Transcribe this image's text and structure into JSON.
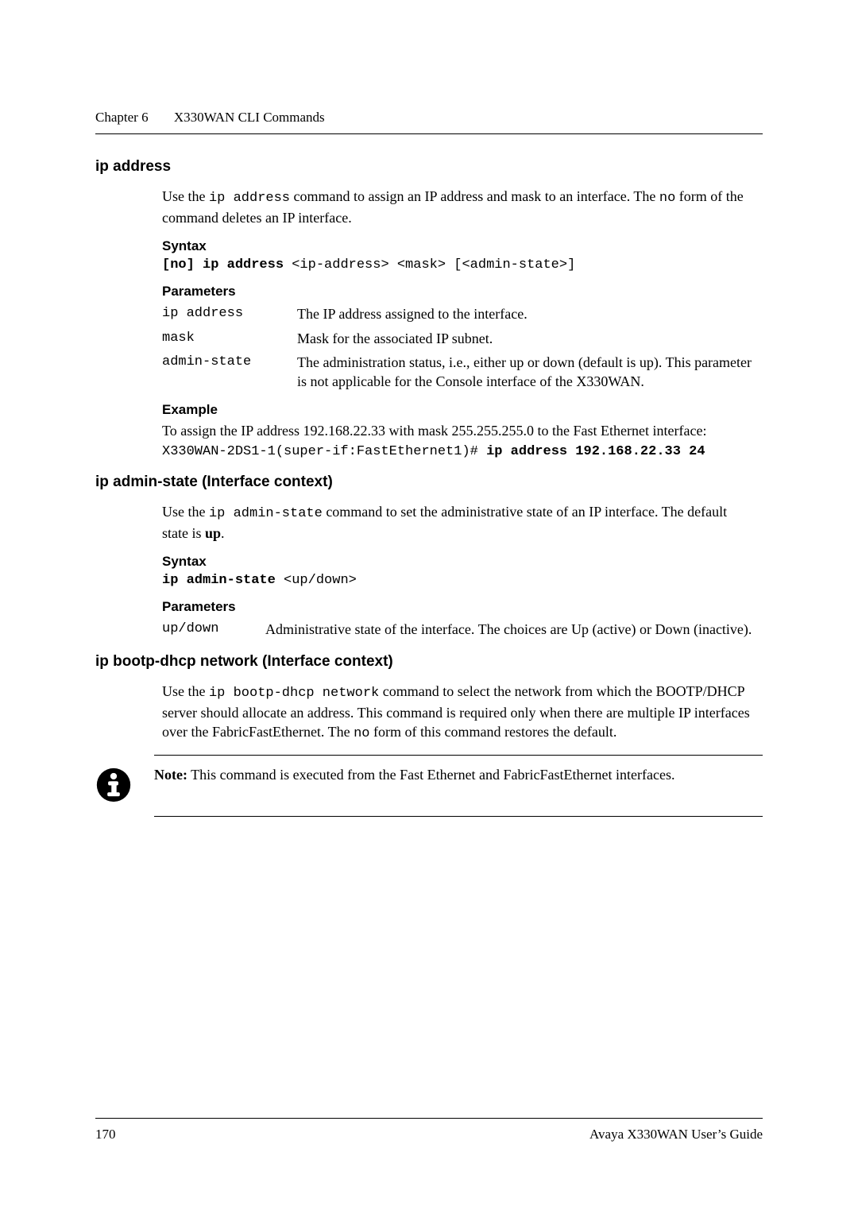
{
  "runhead": {
    "chapter": "Chapter 6",
    "title": "X330WAN CLI Commands"
  },
  "sec1": {
    "title": "ip address",
    "intro_pre": "Use the  ",
    "intro_code": "ip address",
    "intro_mid": "  command to assign an IP address and mask to an interface. The ",
    "intro_code2": "no",
    "intro_post": " form of the command deletes an IP interface.",
    "syntax_head": "Syntax",
    "syntax_bold": "[no] ip address",
    "syntax_rest": " <ip-address> <mask> [<admin-state>]",
    "params_head": "Parameters",
    "params": [
      {
        "key": "ip address",
        "desc": "The IP address assigned to the interface."
      },
      {
        "key": "mask",
        "desc": "Mask for the associated IP subnet."
      },
      {
        "key": "admin-state",
        "desc": "The administration status, i.e., either up or down (default is up). This parameter is not applicable for the Console interface of the X330WAN."
      }
    ],
    "example_head": "Example",
    "example_intro": "To assign the IP address 192.168.22.33 with mask 255.255.255.0 to the Fast Ethernet interface:",
    "example_prompt": "X330WAN-2DS1-1(super-if:FastEthernet1)# ",
    "example_bold": "ip address 192.168.22.33 24"
  },
  "sec2": {
    "title": "ip admin-state (Interface context)",
    "intro_pre": "Use the  ",
    "intro_code": "ip admin-state",
    "intro_mid": " command to set the administrative state of an IP interface. The default state is ",
    "intro_bold": "up",
    "intro_post": ".",
    "syntax_head": "Syntax",
    "syntax_bold": "ip admin-state",
    "syntax_rest": " <up/down>",
    "params_head": "Parameters",
    "params": [
      {
        "key": "up/down",
        "desc": "Administrative state of the interface. The choices are Up (active) or Down (inactive)."
      }
    ]
  },
  "sec3": {
    "title": "ip bootp-dhcp network (Interface context)",
    "intro_pre": "Use the ",
    "intro_code": "ip bootp-dhcp network",
    "intro_mid": "  command to select the network from which the BOOTP/DHCP server should allocate an address. This command is required only when there are multiple IP interfaces over the FabricFastEthernet. The  ",
    "intro_code2": "no",
    "intro_post": " form of this command restores the default.",
    "note_label": "Note:",
    "note_text": "  This command is executed from the Fast Ethernet and FabricFastEthernet interfaces."
  },
  "footer": {
    "page": "170",
    "book": "Avaya X330WAN User’s Guide"
  }
}
